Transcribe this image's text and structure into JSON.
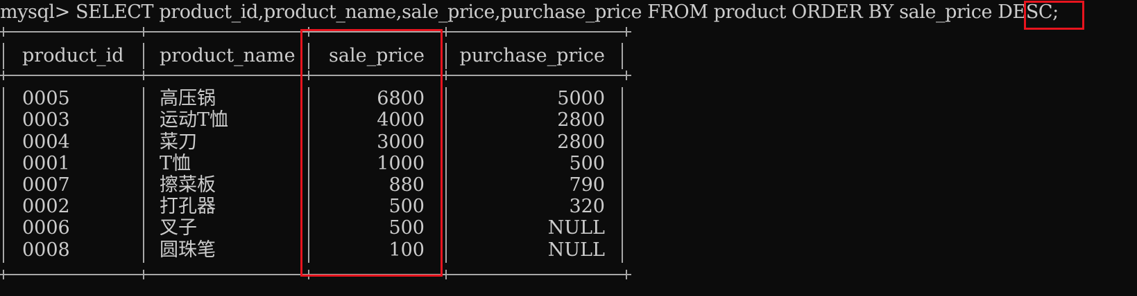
{
  "prompt": {
    "text": "mysql> SELECT product_id,product_name,sale_price,purchase_price FROM product ORDER BY sale_price ",
    "highlighted": "DESC;"
  },
  "table": {
    "headers": [
      "product_id",
      "product_name",
      "sale_price",
      "purchase_price"
    ],
    "rows": [
      [
        "0005",
        "高压锅",
        "6800",
        "5000"
      ],
      [
        "0003",
        "运动T恤",
        "4000",
        "2800"
      ],
      [
        "0004",
        "菜刀",
        "3000",
        "2800"
      ],
      [
        "0001",
        "T恤",
        "1000",
        "500"
      ],
      [
        "0007",
        "擦菜板",
        "880",
        "790"
      ],
      [
        "0002",
        "打孔器",
        "500",
        "320"
      ],
      [
        "0006",
        "叉子",
        "500",
        "NULL"
      ],
      [
        "0008",
        "圆珠笔",
        "100",
        "NULL"
      ]
    ]
  },
  "colors": {
    "background": "#0c0c0c",
    "text": "#cccccc",
    "highlight": "#e8141e"
  }
}
